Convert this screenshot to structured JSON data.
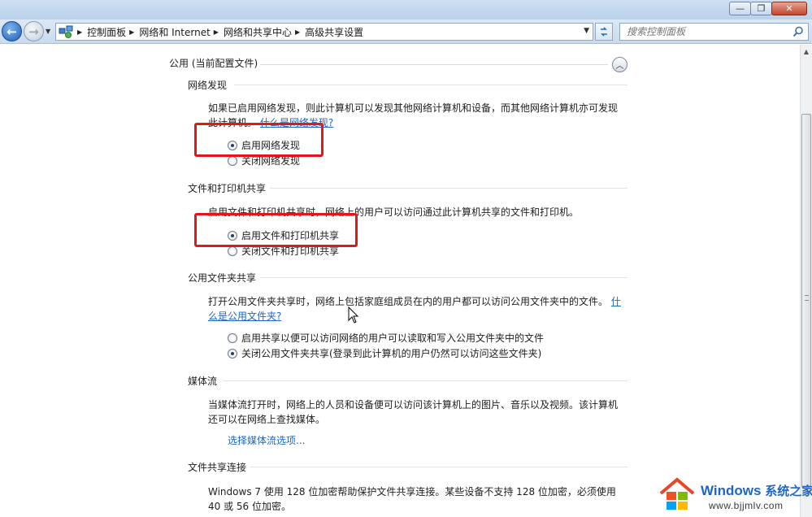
{
  "window": {
    "minimize": "—",
    "maximize": "❐",
    "close": "✕"
  },
  "nav": {
    "back": "←",
    "forward": "→"
  },
  "address": {
    "crumbs": [
      "控制面板",
      "网络和 Internet",
      "网络和共享中心",
      "高级共享设置"
    ]
  },
  "search": {
    "placeholder": "搜索控制面板"
  },
  "profile": {
    "title": "公用 (当前配置文件)"
  },
  "network_discovery": {
    "title": "网络发现",
    "desc": "如果已启用网络发现，则此计算机可以发现其他网络计算机和设备，而其他网络计算机亦可发现此计算机。",
    "link": "什么是网络发现?",
    "options": [
      "启用网络发现",
      "关闭网络发现"
    ],
    "selected": 0
  },
  "file_printer": {
    "title": "文件和打印机共享",
    "desc": "启用文件和打印机共享时，网络上的用户可以访问通过此计算机共享的文件和打印机。",
    "options": [
      "启用文件和打印机共享",
      "关闭文件和打印机共享"
    ],
    "selected": 0
  },
  "public_folder": {
    "title": "公用文件夹共享",
    "desc": "打开公用文件夹共享时，网络上包括家庭组成员在内的用户都可以访问公用文件夹中的文件。",
    "link": "什么是公用文件夹?",
    "options": [
      "启用共享以便可以访问网络的用户可以读取和写入公用文件夹中的文件",
      "关闭公用文件夹共享(登录到此计算机的用户仍然可以访问这些文件夹)"
    ],
    "selected": 1
  },
  "media": {
    "title": "媒体流",
    "desc": "当媒体流打开时，网络上的人员和设备便可以访问该计算机上的图片、音乐以及视频。该计算机还可以在网络上查找媒体。",
    "link": "选择媒体流选项..."
  },
  "file_sharing": {
    "title": "文件共享连接",
    "desc": "Windows 7 使用 128 位加密帮助保护文件共享连接。某些设备不支持 128 位加密，必须使用 40 或 56 位加密。"
  },
  "watermark": {
    "brand": "Windows",
    "cn": "系统之家",
    "url": "www.bjjmlv.com"
  },
  "colors": {
    "accent_link": "#1f65c2",
    "highlight": "#e3161a"
  }
}
